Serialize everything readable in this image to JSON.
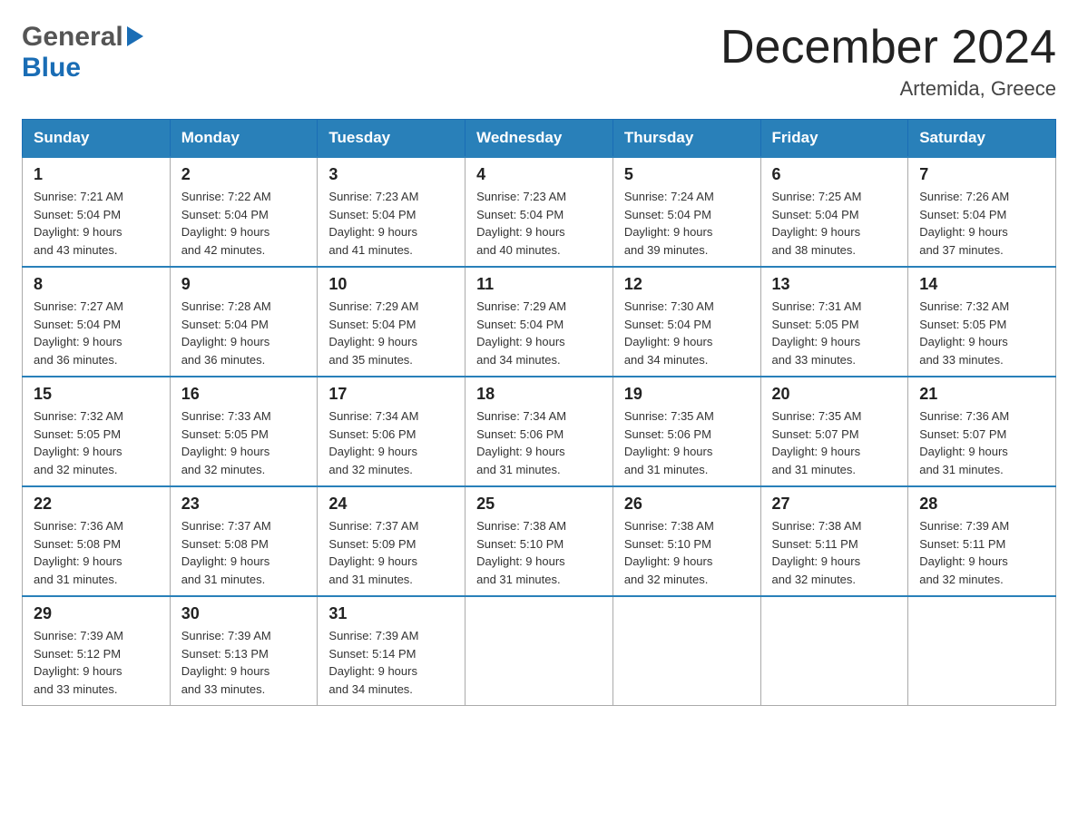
{
  "header": {
    "logo_general": "General",
    "logo_blue": "Blue",
    "month_title": "December 2024",
    "location": "Artemida, Greece"
  },
  "weekdays": [
    "Sunday",
    "Monday",
    "Tuesday",
    "Wednesday",
    "Thursday",
    "Friday",
    "Saturday"
  ],
  "weeks": [
    [
      {
        "day": "1",
        "sunrise": "7:21 AM",
        "sunset": "5:04 PM",
        "daylight": "9 hours and 43 minutes."
      },
      {
        "day": "2",
        "sunrise": "7:22 AM",
        "sunset": "5:04 PM",
        "daylight": "9 hours and 42 minutes."
      },
      {
        "day": "3",
        "sunrise": "7:23 AM",
        "sunset": "5:04 PM",
        "daylight": "9 hours and 41 minutes."
      },
      {
        "day": "4",
        "sunrise": "7:23 AM",
        "sunset": "5:04 PM",
        "daylight": "9 hours and 40 minutes."
      },
      {
        "day": "5",
        "sunrise": "7:24 AM",
        "sunset": "5:04 PM",
        "daylight": "9 hours and 39 minutes."
      },
      {
        "day": "6",
        "sunrise": "7:25 AM",
        "sunset": "5:04 PM",
        "daylight": "9 hours and 38 minutes."
      },
      {
        "day": "7",
        "sunrise": "7:26 AM",
        "sunset": "5:04 PM",
        "daylight": "9 hours and 37 minutes."
      }
    ],
    [
      {
        "day": "8",
        "sunrise": "7:27 AM",
        "sunset": "5:04 PM",
        "daylight": "9 hours and 36 minutes."
      },
      {
        "day": "9",
        "sunrise": "7:28 AM",
        "sunset": "5:04 PM",
        "daylight": "9 hours and 36 minutes."
      },
      {
        "day": "10",
        "sunrise": "7:29 AM",
        "sunset": "5:04 PM",
        "daylight": "9 hours and 35 minutes."
      },
      {
        "day": "11",
        "sunrise": "7:29 AM",
        "sunset": "5:04 PM",
        "daylight": "9 hours and 34 minutes."
      },
      {
        "day": "12",
        "sunrise": "7:30 AM",
        "sunset": "5:04 PM",
        "daylight": "9 hours and 34 minutes."
      },
      {
        "day": "13",
        "sunrise": "7:31 AM",
        "sunset": "5:05 PM",
        "daylight": "9 hours and 33 minutes."
      },
      {
        "day": "14",
        "sunrise": "7:32 AM",
        "sunset": "5:05 PM",
        "daylight": "9 hours and 33 minutes."
      }
    ],
    [
      {
        "day": "15",
        "sunrise": "7:32 AM",
        "sunset": "5:05 PM",
        "daylight": "9 hours and 32 minutes."
      },
      {
        "day": "16",
        "sunrise": "7:33 AM",
        "sunset": "5:05 PM",
        "daylight": "9 hours and 32 minutes."
      },
      {
        "day": "17",
        "sunrise": "7:34 AM",
        "sunset": "5:06 PM",
        "daylight": "9 hours and 32 minutes."
      },
      {
        "day": "18",
        "sunrise": "7:34 AM",
        "sunset": "5:06 PM",
        "daylight": "9 hours and 31 minutes."
      },
      {
        "day": "19",
        "sunrise": "7:35 AM",
        "sunset": "5:06 PM",
        "daylight": "9 hours and 31 minutes."
      },
      {
        "day": "20",
        "sunrise": "7:35 AM",
        "sunset": "5:07 PM",
        "daylight": "9 hours and 31 minutes."
      },
      {
        "day": "21",
        "sunrise": "7:36 AM",
        "sunset": "5:07 PM",
        "daylight": "9 hours and 31 minutes."
      }
    ],
    [
      {
        "day": "22",
        "sunrise": "7:36 AM",
        "sunset": "5:08 PM",
        "daylight": "9 hours and 31 minutes."
      },
      {
        "day": "23",
        "sunrise": "7:37 AM",
        "sunset": "5:08 PM",
        "daylight": "9 hours and 31 minutes."
      },
      {
        "day": "24",
        "sunrise": "7:37 AM",
        "sunset": "5:09 PM",
        "daylight": "9 hours and 31 minutes."
      },
      {
        "day": "25",
        "sunrise": "7:38 AM",
        "sunset": "5:10 PM",
        "daylight": "9 hours and 31 minutes."
      },
      {
        "day": "26",
        "sunrise": "7:38 AM",
        "sunset": "5:10 PM",
        "daylight": "9 hours and 32 minutes."
      },
      {
        "day": "27",
        "sunrise": "7:38 AM",
        "sunset": "5:11 PM",
        "daylight": "9 hours and 32 minutes."
      },
      {
        "day": "28",
        "sunrise": "7:39 AM",
        "sunset": "5:11 PM",
        "daylight": "9 hours and 32 minutes."
      }
    ],
    [
      {
        "day": "29",
        "sunrise": "7:39 AM",
        "sunset": "5:12 PM",
        "daylight": "9 hours and 33 minutes."
      },
      {
        "day": "30",
        "sunrise": "7:39 AM",
        "sunset": "5:13 PM",
        "daylight": "9 hours and 33 minutes."
      },
      {
        "day": "31",
        "sunrise": "7:39 AM",
        "sunset": "5:14 PM",
        "daylight": "9 hours and 34 minutes."
      },
      null,
      null,
      null,
      null
    ]
  ]
}
